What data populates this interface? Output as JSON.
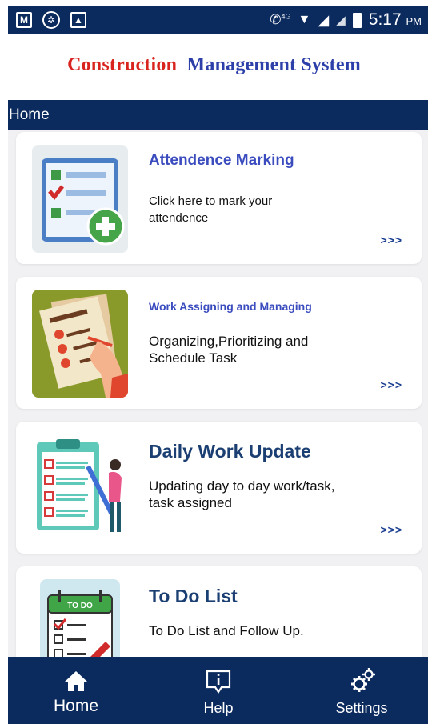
{
  "status_bar": {
    "time": "5:17",
    "ampm": "PM",
    "network": "4G"
  },
  "app": {
    "title_part1": "Construction",
    "title_part2": "Management System"
  },
  "nav": {
    "title": "Home"
  },
  "cards": [
    {
      "title": "Attendence Marking",
      "desc_line1": "Click here to mark your",
      "desc_line2": "attendence",
      "arrow": ">>>"
    },
    {
      "title": "Work Assigning and Managing",
      "desc_line1": "Organizing,Prioritizing and",
      "desc_line2": "Schedule Task",
      "arrow": ">>>"
    },
    {
      "title": "Daily Work Update",
      "desc_line1": "Updating day to day work/task,",
      "desc_line2": "task assigned",
      "arrow": ">>>"
    },
    {
      "title": "To Do List",
      "desc_line1": "To Do List and Follow Up.",
      "desc_line2": "",
      "arrow": ""
    }
  ],
  "todo_badge": "TO DO",
  "bottom_nav": [
    {
      "label": "Home",
      "icon": "home-icon"
    },
    {
      "label": "Help",
      "icon": "help-icon"
    },
    {
      "label": "Settings",
      "icon": "settings-icon"
    }
  ],
  "colors": {
    "primary": "#0b2a5e",
    "title_red": "#d8231f",
    "title_blue": "#2d3fa8",
    "card_title_blue": "#1b3f92"
  }
}
